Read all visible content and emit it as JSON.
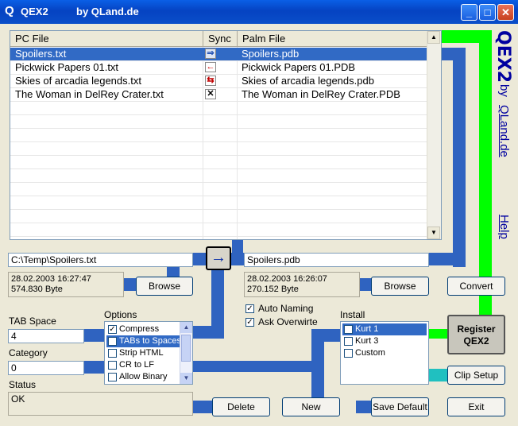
{
  "window": {
    "title": "QEX2",
    "subtitle": "by QLand.de",
    "buttons": {
      "minimize": "_",
      "maximize": "□",
      "close": "✕"
    }
  },
  "file_list": {
    "columns": [
      "PC File",
      "Sync",
      "Palm File"
    ],
    "rows": [
      {
        "pc": "Spoilers.txt",
        "sync": "⇒",
        "palm": "Spoilers.pdb",
        "selected": true
      },
      {
        "pc": "Pickwick Papers 01.txt",
        "sync": "←",
        "palm": "Pickwick Papers 01.PDB",
        "selected": false
      },
      {
        "pc": "Skies of arcadia legends.txt",
        "sync": "⇆",
        "palm": "Skies of arcadia legends.pdb",
        "selected": false
      },
      {
        "pc": "The Woman in DelRey Crater.txt",
        "sync": "✕",
        "palm": "The Woman in DelRey Crater.PDB",
        "selected": false
      }
    ]
  },
  "pc_side": {
    "path": "C:\\Temp\\Spoilers.txt",
    "date": "28.02.2003 16:27:47",
    "size": "574.830 Byte",
    "browse_label": "Browse"
  },
  "transfer_arrow": "→",
  "palm_side": {
    "name": "Spoilers.pdb",
    "date": "28.02.2003 16:26:07",
    "size": "270.152 Byte",
    "browse_label": "Browse"
  },
  "convert_label": "Convert",
  "tab_space": {
    "label": "TAB Space",
    "value": "4"
  },
  "category": {
    "label": "Category",
    "value": "0"
  },
  "status": {
    "label": "Status",
    "value": "OK"
  },
  "options": {
    "label": "Options",
    "items": [
      {
        "label": "Compress",
        "checked": true,
        "selected": false
      },
      {
        "label": "TABs to Spaces",
        "checked": true,
        "selected": true
      },
      {
        "label": "Strip HTML",
        "checked": false,
        "selected": false
      },
      {
        "label": "CR to LF",
        "checked": false,
        "selected": false
      },
      {
        "label": "Allow Binary",
        "checked": false,
        "selected": false
      }
    ]
  },
  "auto_naming": {
    "label": "Auto Naming",
    "checked": true
  },
  "ask_overwrite": {
    "label": "Ask Overwirte",
    "checked": true
  },
  "install": {
    "label": "Install",
    "items": [
      {
        "label": "Kurt 1",
        "checked": true,
        "selected": true
      },
      {
        "label": "Kurt 3",
        "checked": false,
        "selected": false
      },
      {
        "label": "Custom",
        "checked": false,
        "selected": false
      }
    ]
  },
  "register_label": [
    "Register",
    "QEX2"
  ],
  "clip_setup_label": "Clip Setup",
  "delete_label": "Delete",
  "new_label": "New",
  "save_default_label": "Save Default",
  "exit_label": "Exit",
  "side_banner": {
    "brand": "QEX2",
    "by": "by",
    "site": "QLand.de",
    "help": "Help"
  },
  "colors": {
    "accent_blue": "#2f63c0",
    "accent_green": "#00ff00",
    "accent_teal": "#20c0c0",
    "selection": "#316ac5"
  }
}
